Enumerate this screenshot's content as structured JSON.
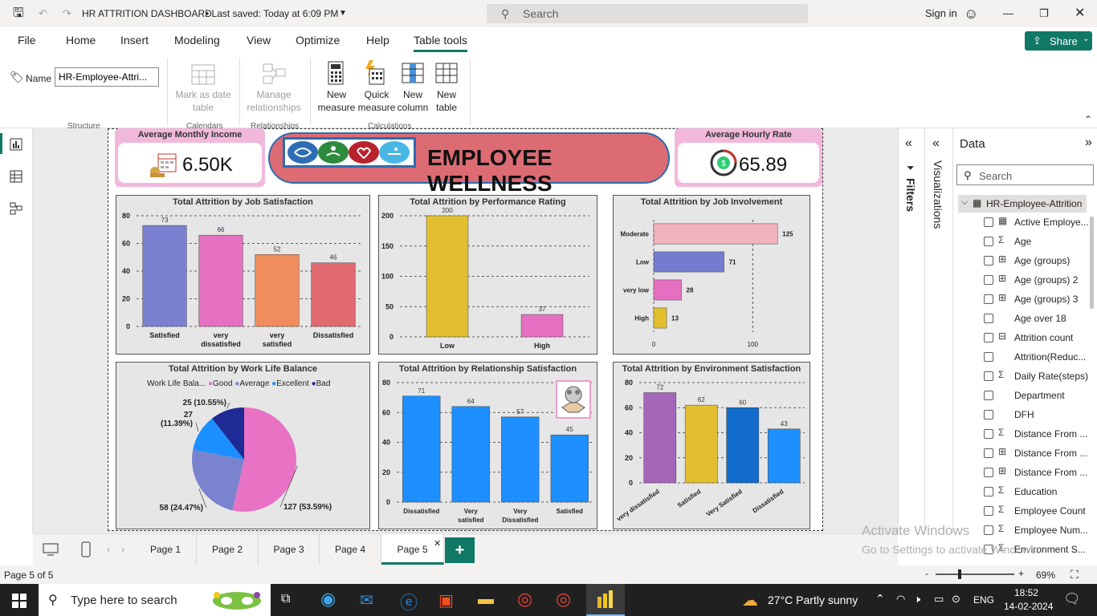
{
  "app": {
    "title": "HR ATTRITION DASHBOARD",
    "saved": "• Last saved: Today at 6:09 PM",
    "search_placeholder": "Search",
    "sign_in": "Sign in"
  },
  "menu": [
    "File",
    "Home",
    "Insert",
    "Modeling",
    "View",
    "Optimize",
    "Help",
    "Table tools"
  ],
  "share": "Share",
  "ribbon": {
    "name_label": "Name",
    "name_value": "HR-Employee-Attri...",
    "structure": "Structure",
    "mark_as_date": "Mark as date table",
    "calendars": "Calendars",
    "manage_rel": "Manage relationships",
    "relationships": "Relationships",
    "new_measure": "New measure",
    "quick_measure": "Quick measure",
    "new_column": "New column",
    "new_table": "New table",
    "calculations": "Calculations"
  },
  "report": {
    "kpi_income": {
      "title": "Average Monthly Income",
      "value": "6.50K"
    },
    "kpi_hourly": {
      "title": "Average Hourly Rate",
      "value": "65.89"
    },
    "banner": "EMPLOYEE WELLNESS"
  },
  "chart_data": [
    {
      "type": "bar",
      "title": "Total Attrition by Job Satisfaction",
      "categories": [
        "Satisfied",
        "very dissatisfied",
        "very satisfied",
        "Dissatisfied"
      ],
      "values": [
        73,
        66,
        52,
        46
      ],
      "yticks": [
        0,
        20,
        40,
        60,
        80
      ],
      "ylim": [
        0,
        80
      ],
      "colors": [
        "#7a7fcf",
        "#e570c2",
        "#f08d5d",
        "#e06a70"
      ]
    },
    {
      "type": "bar",
      "title": "Total Attrition by Performance Rating",
      "categories": [
        "Low",
        "High"
      ],
      "values": [
        200,
        37
      ],
      "yticks": [
        0,
        50,
        100,
        150,
        200
      ],
      "ylim": [
        0,
        200
      ],
      "colors": [
        "#e3bf30",
        "#e570c2"
      ]
    },
    {
      "type": "bar",
      "orientation": "horizontal",
      "title": "Total Attrition by Job Involvement",
      "categories": [
        "Moderate",
        "Low",
        "very low",
        "High"
      ],
      "values": [
        125,
        71,
        28,
        13
      ],
      "xticks": [
        0,
        100
      ],
      "xlim": [
        0,
        150
      ],
      "colors": [
        "#f1b3bd",
        "#737cce",
        "#e570c2",
        "#e3bf30"
      ]
    },
    {
      "type": "pie",
      "title": "Total Attrition by Work Life Balance",
      "legend_title": "Work Life Bala...",
      "legend": [
        "Good",
        "Average",
        "Excellent",
        "Bad"
      ],
      "values": [
        127,
        58,
        27,
        25
      ],
      "labels": [
        "127 (53.59%)",
        "58 (24.47%)",
        "27 (11.39%)",
        "25 (10.55%)"
      ],
      "colors": [
        "#e872c3",
        "#7a83cd",
        "#1b8fff",
        "#1e2a96"
      ]
    },
    {
      "type": "bar",
      "title": "Total Attrition by Relationship Satisfaction",
      "categories": [
        "Dissatisfied",
        "Very satisfied",
        "Very Dissatisfied",
        "Satisfied"
      ],
      "values": [
        71,
        64,
        57,
        45
      ],
      "yticks": [
        0,
        20,
        40,
        60,
        80
      ],
      "ylim": [
        0,
        80
      ],
      "colors": [
        "#1e8fff",
        "#1e8fff",
        "#1e8fff",
        "#1e8fff"
      ]
    },
    {
      "type": "bar",
      "title": "Total Attrition by Environment Satisfaction",
      "categories": [
        "very dissatisfied",
        "Satisfied",
        "Very Satisfied",
        "Dissatisfied"
      ],
      "values": [
        72,
        62,
        60,
        43
      ],
      "yticks": [
        0,
        20,
        40,
        60,
        80
      ],
      "ylim": [
        0,
        80
      ],
      "colors": [
        "#a466b8",
        "#e3bf30",
        "#116ccc",
        "#1e8fff"
      ]
    }
  ],
  "panes": {
    "filters": "Filters",
    "visualizations": "Visualizations",
    "data": "Data",
    "search": "Search",
    "table": "HR-Employee-Attrition"
  },
  "fields": [
    {
      "icon": "calc",
      "name": "Active Employe..."
    },
    {
      "icon": "sigma",
      "name": "Age"
    },
    {
      "icon": "group",
      "name": "Age (groups)"
    },
    {
      "icon": "group",
      "name": "Age (groups) 2"
    },
    {
      "icon": "group",
      "name": "Age (groups) 3"
    },
    {
      "icon": "none",
      "name": "Age over 18"
    },
    {
      "icon": "table",
      "name": "Attrition count"
    },
    {
      "icon": "none",
      "name": "Attrition(Reduc..."
    },
    {
      "icon": "sigma",
      "name": "Daily Rate(steps)"
    },
    {
      "icon": "none",
      "name": "Department"
    },
    {
      "icon": "none",
      "name": "DFH"
    },
    {
      "icon": "sigma",
      "name": "Distance From ..."
    },
    {
      "icon": "group",
      "name": "Distance From ..."
    },
    {
      "icon": "group",
      "name": "Distance From ..."
    },
    {
      "icon": "sigma",
      "name": "Education"
    },
    {
      "icon": "sigma",
      "name": "Employee Count"
    },
    {
      "icon": "sigma",
      "name": "Employee Num..."
    },
    {
      "icon": "sigma",
      "name": "Environment S..."
    }
  ],
  "pages": [
    "Page 1",
    "Page 2",
    "Page 3",
    "Page 4",
    "Page 5"
  ],
  "active_page": "Page 5",
  "status": {
    "page": "Page 5 of 5",
    "zoom": "69%"
  },
  "watermark": {
    "line1": "Activate Windows",
    "line2": "Go to Settings to activate Windows."
  },
  "taskbar": {
    "search": "Type here to search",
    "weather": "27°C  Partly sunny",
    "lang": "ENG",
    "time": "18:52",
    "date": "14-02-2024"
  }
}
